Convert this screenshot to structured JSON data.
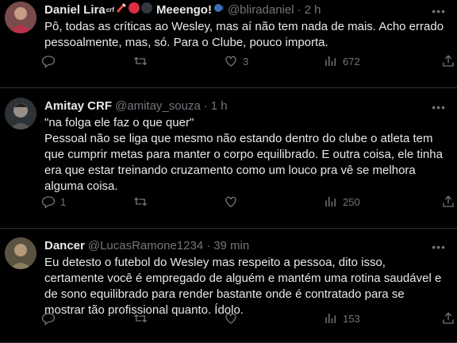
{
  "tweets": [
    {
      "name": "Daniel Lira",
      "name_badge": "crf",
      "name_suffix": "Meeengo!",
      "handle": "@bliradaniel",
      "time": "2 h",
      "text": "Pô, todas as críticas ao Wesley, mas aí não tem nada de mais. Acho errado pessoalmente, mas, só. Para o Clube, pouco importa.",
      "replies": "",
      "retweets": "",
      "likes": "3",
      "views": "672"
    },
    {
      "name": "Amitay CRF",
      "handle": "@amitay_souza",
      "time": "1 h",
      "text": "\"na folga ele faz o que quer\"\nPessoal não se liga que mesmo não estando dentro do clube o atleta tem que cumprir metas para manter o corpo equilibrado. E outra coisa, ele tinha era que estar treinando cruzamento como um louco pra vê se melhora alguma coisa.",
      "replies": "1",
      "retweets": "",
      "likes": "",
      "views": "250"
    },
    {
      "name": "Dancer",
      "handle": "@LucasRamone1234",
      "time": "39 min",
      "text": "Eu detesto o futebol do Wesley mas respeito a pessoa, dito isso, certamente você é empregado de alguém e mantém uma rotina saudável e de sono equilibrado para render bastante onde é contratado para se mostrar tão profissional quanto. Ídolo.",
      "replies": "",
      "retweets": "",
      "likes": "",
      "views": "153"
    }
  ],
  "icons": {
    "reply": "reply-icon",
    "retweet": "retweet-icon",
    "like": "heart-icon",
    "views": "views-icon",
    "bookmark": "bookmark-icon",
    "share": "share-icon",
    "more": "more-icon"
  },
  "colors": {
    "background": "#000000",
    "text": "#e7e9ea",
    "muted": "#71767b",
    "divider": "#2f3336"
  }
}
